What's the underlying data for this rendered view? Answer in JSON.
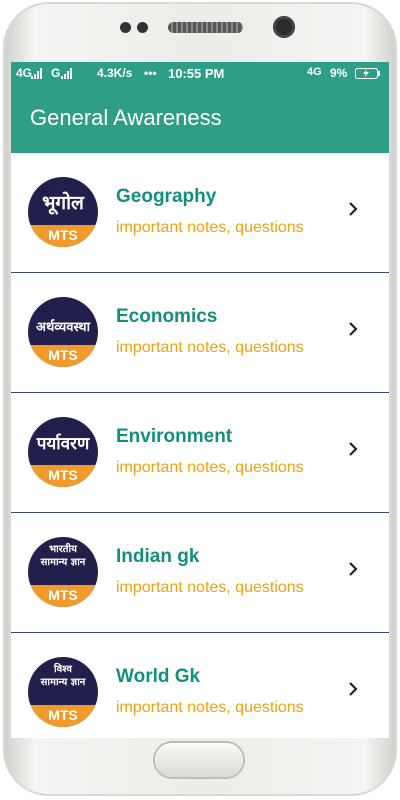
{
  "status": {
    "sig1": "4G",
    "sig2": "G",
    "speed": "4.3K/s",
    "dots": "•••",
    "time": "10:55 PM",
    "net": "4G",
    "battery": "9%"
  },
  "appbar": {
    "title": "General Awareness"
  },
  "items": [
    {
      "name": "Geography",
      "sub": "important notes, questions",
      "logo_text": "भूगोल",
      "badge": "MTS"
    },
    {
      "name": "Economics",
      "sub": "important notes, questions",
      "logo_text": "अर्थव्यवस्था",
      "badge": "MTS"
    },
    {
      "name": "Environment",
      "sub": "important notes, questions",
      "logo_text": "पर्यावरण",
      "badge": "MTS"
    },
    {
      "name": "Indian gk",
      "sub": "important notes, questions",
      "logo_text": "भारतीय सामान्य ज्ञान",
      "badge": "MTS"
    },
    {
      "name": "World Gk",
      "sub": "important notes, questions",
      "logo_text": "विश्व सामान्य ज्ञान",
      "badge": "MTS"
    }
  ],
  "icons": {
    "chevron": "chevron-right-icon"
  },
  "colors": {
    "primary": "#2e9e86",
    "title_text": "#13907a",
    "subtitle_text": "#f0a20e",
    "divider": "#39458c",
    "logo_bg": "#231f4c",
    "badge": "#f09a2c"
  }
}
